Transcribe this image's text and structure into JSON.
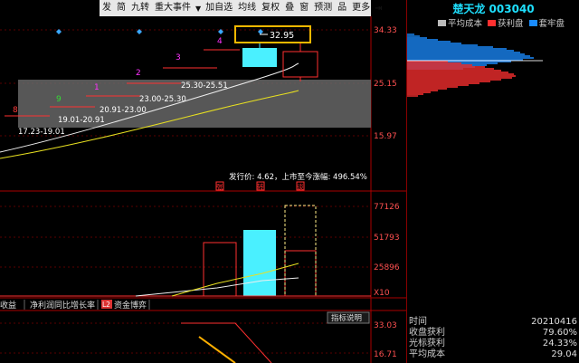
{
  "toolbar": {
    "items": [
      "发",
      "简",
      "九转",
      "重大事件"
    ],
    "items2": [
      "加自选",
      "均线",
      "复权",
      "叠",
      "窗",
      "预测",
      "品",
      "更多"
    ]
  },
  "stock": {
    "name": "楚天龙",
    "code": "003040"
  },
  "price_axis": [
    "34.33",
    "25.15",
    "15.97"
  ],
  "callout": "32.95",
  "issue_info": "发行价: 4.62，上市至今涨幅: 496.54%",
  "markers": {
    "zhang": "张",
    "zhuan": "转",
    "tan": "谈"
  },
  "steps": [
    {
      "n": "8",
      "range": "17.23-19.01",
      "color": "#ff3b3b"
    },
    {
      "n": "9",
      "range": "19.01-20.91",
      "color": "#33dd33"
    },
    {
      "n": "1",
      "range": "20.91-23.00",
      "color": "#ff33ff"
    },
    {
      "n": "2",
      "range": "23.00-25.30",
      "color": "#ff33ff"
    },
    {
      "n": "3",
      "range": "25.30-25.51",
      "color": "#ff33ff"
    },
    {
      "n": "4",
      "range": "",
      "color": "#ff33ff"
    }
  ],
  "volume_axis": [
    "77126",
    "51793",
    "25896",
    "X10"
  ],
  "indicator_tabs": [
    "收益",
    "净利润同比增长率",
    "资金博弈"
  ],
  "indicator_badge": "L2",
  "indicator_button": "指标说明",
  "indicator_axis": [
    "33.03",
    "16.71"
  ],
  "legend": [
    {
      "label": "平均成本",
      "color": "#bbbbbb"
    },
    {
      "label": "获利盘",
      "color": "#ff3030"
    },
    {
      "label": "套牢盘",
      "color": "#1a8cff"
    }
  ],
  "stats": [
    {
      "k": "时间",
      "v": "20210416"
    },
    {
      "k": "收盘获利",
      "v": "79.60%"
    },
    {
      "k": "光标获利",
      "v": "24.33%"
    },
    {
      "k": "平均成本",
      "v": "29.04"
    }
  ]
}
